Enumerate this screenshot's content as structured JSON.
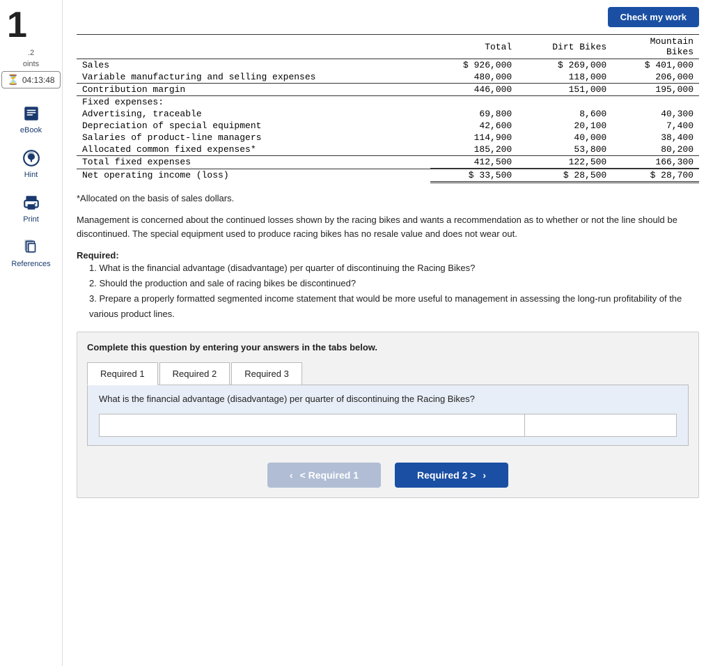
{
  "sidebar": {
    "problem_number": "1",
    "points_label": ".2",
    "points_sub": "oints",
    "timer": "04:13:48",
    "nav_items": [
      {
        "id": "ebook",
        "icon": "📖",
        "label": "eBook"
      },
      {
        "id": "hint",
        "icon": "🌐",
        "label": "Hint"
      },
      {
        "id": "print",
        "icon": "🖨",
        "label": "Print"
      },
      {
        "id": "references",
        "icon": "📋",
        "label": "References"
      }
    ]
  },
  "check_button": "Check my work",
  "table": {
    "headers": [
      "",
      "Total",
      "Dirt Bikes",
      "Mountain\nBikes"
    ],
    "rows": [
      {
        "label": "Sales",
        "indent": 0,
        "total": "$ 926,000",
        "dirt": "$ 269,000",
        "mountain": "$ 401,000",
        "border": ""
      },
      {
        "label": "Variable manufacturing and selling expenses",
        "indent": 0,
        "total": "480,000",
        "dirt": "118,000",
        "mountain": "206,000",
        "border": "bottom"
      },
      {
        "label": "Contribution margin",
        "indent": 0,
        "total": "446,000",
        "dirt": "151,000",
        "mountain": "195,000",
        "border": "bottom"
      },
      {
        "label": "Fixed expenses:",
        "indent": 0,
        "total": "",
        "dirt": "",
        "mountain": "",
        "border": ""
      },
      {
        "label": "Advertising, traceable",
        "indent": 2,
        "total": "69,800",
        "dirt": "8,600",
        "mountain": "40,300",
        "border": ""
      },
      {
        "label": "Depreciation of special equipment",
        "indent": 2,
        "total": "42,600",
        "dirt": "20,100",
        "mountain": "7,400",
        "border": ""
      },
      {
        "label": "Salaries of product-line managers",
        "indent": 2,
        "total": "114,900",
        "dirt": "40,000",
        "mountain": "38,400",
        "border": ""
      },
      {
        "label": "Allocated common fixed expenses*",
        "indent": 2,
        "total": "185,200",
        "dirt": "53,800",
        "mountain": "80,200",
        "border": "bottom"
      },
      {
        "label": "Total fixed expenses",
        "indent": 0,
        "total": "412,500",
        "dirt": "122,500",
        "mountain": "166,300",
        "border": "bottom"
      },
      {
        "label": "Net operating income (loss)",
        "indent": 0,
        "total": "$ 33,500",
        "dirt": "$ 28,500",
        "mountain": "$ 28,700",
        "border": "double"
      }
    ]
  },
  "allocated_note": "*Allocated on the basis of sales dollars.",
  "description": "Management is concerned about the continued losses shown by the racing bikes and wants a recommendation as to whether or not the line should be discontinued. The special equipment used to produce racing bikes has no resale value and does not wear out.",
  "required_label": "Required:",
  "required_items": [
    "What is the financial advantage (disadvantage) per quarter of discontinuing the Racing Bikes?",
    "Should the production and sale of racing bikes be discontinued?",
    "Prepare a properly formatted segmented income statement that would be more useful to management in assessing the long-run profitability of the various product lines."
  ],
  "answer_box": {
    "instruction": "Complete this question by entering your answers in the tabs below.",
    "tabs": [
      {
        "id": "req1",
        "label": "Required 1",
        "active": true
      },
      {
        "id": "req2",
        "label": "Required 2",
        "active": false
      },
      {
        "id": "req3",
        "label": "Required 3",
        "active": false
      }
    ],
    "tab_question": "What is the financial advantage (disadvantage) per quarter of discontinuing the Racing Bikes?",
    "input_placeholder": "",
    "value_placeholder": "",
    "nav_prev_label": "< Required 1",
    "nav_next_label": "Required 2 >"
  }
}
